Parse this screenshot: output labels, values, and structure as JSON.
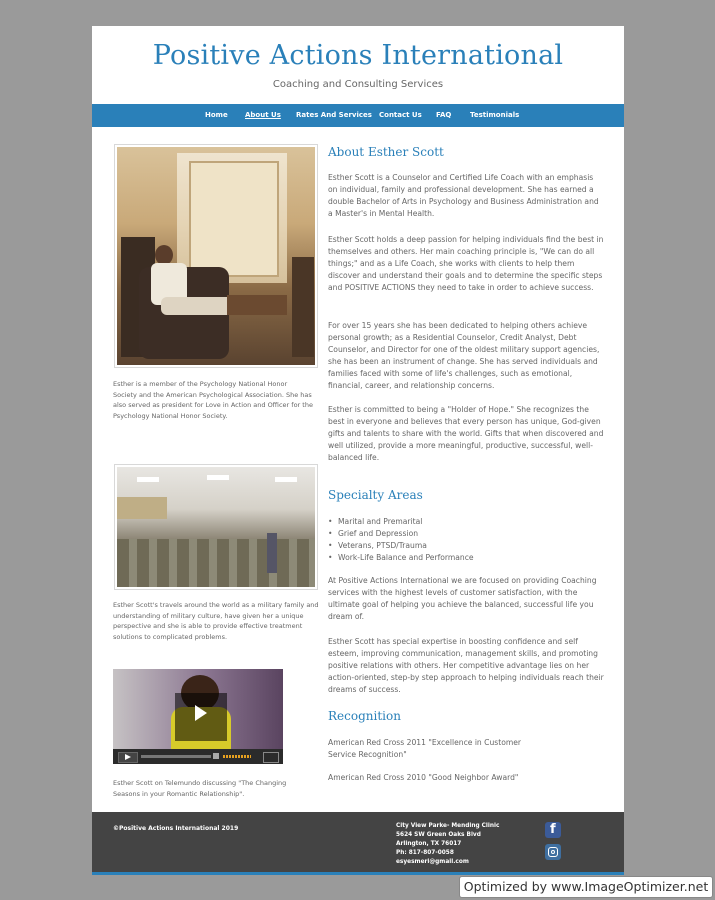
{
  "header": {
    "title": "Positive Actions International",
    "tagline": "Coaching and Consulting Services"
  },
  "nav": {
    "items": [
      "Home",
      "About Us",
      "Rates And Services",
      "Contact Us",
      "FAQ",
      "Testimonials"
    ],
    "active": "About Us"
  },
  "sidebar": {
    "caption1": "Esther is a member of the Psychology National Honor Society and the American Psychological Association.  She has also served as president for Love in Action and Officer for the Psychology National Honor Society.",
    "caption2": "Esther Scott's travels around the world as a military family and understanding of military culture, have given her a unique perspective and she is able to provide effective treatment solutions to complicated problems.",
    "caption3": "Esther Scott on Telemundo discussing \"The Changing Seasons in your Romantic Relationship\"."
  },
  "about": {
    "heading": "About Esther Scott",
    "p1": "Esther Scott is a Counselor and Certified Life Coach with an emphasis on individual, family and professional development.  She has earned a double Bachelor of Arts in Psychology and Business Administration and a Master's in Mental Health.",
    "p2": "Esther Scott holds a deep passion for helping individuals find the best in themselves and others.   Her main coaching principle is, \"We can do all things;\" and as a Life Coach, she works with clients to help them discover and understand their goals and to determine the specific steps and POSITIVE ACTIONS they need to take in order to achieve success.",
    "p3": "For over 15 years she has been dedicated to helping others achieve personal growth; as a Residential Counselor, Credit Analyst, Debt Counselor, and Director for one of the oldest military support agencies, she has been an instrument of change. She has served individuals and families faced with some of life's challenges, such as emotional, financial, career, and relationship concerns.",
    "p4": "Esther is committed to being a \"Holder of Hope.\" She recognizes the best in everyone and believes that every person has unique, God-given gifts and talents to share with the world.  Gifts that when discovered and well utilized, provide a more meaningful, productive, successful, well-balanced life."
  },
  "specialty": {
    "heading": "Specialty Areas",
    "items": [
      "Marital and Premarital",
      "Grief and Depression",
      "Veterans, PTSD/Trauma",
      "Work-Life Balance and Performance"
    ],
    "p1": "At Positive Actions International we are focused on providing Coaching services with the highest levels of customer satisfaction, with the ultimate goal of helping you achieve the  balanced, successful life you dream of.",
    "p2": "Esther Scott has special expertise in boosting confidence and self esteem, improving communication,  management skills, and promoting positive relations with others.  Her competitive advantage lies on her action-oriented, step-by step approach to helping individuals reach their dreams of success."
  },
  "recognition": {
    "heading": "Recognition",
    "p1": "American Red Cross 2011 \"Excellence in Customer Service Recognition\"",
    "p2": "American Red Cross 2010 \"Good Neighbor Award\""
  },
  "footer": {
    "copyright": "©Positive Actions International 2019",
    "address": [
      "City View Parke- Mending Clinic",
      "5624 SW Green Oaks Blvd",
      "Arlington, TX 76017",
      "Ph: 817-807-0058",
      "esyesmeri@gmail.com"
    ]
  },
  "watermark": "Optimized by www.ImageOptimizer.net",
  "colors": {
    "accent": "#2a80b9",
    "footer": "#444444",
    "background": "#9a9a9a"
  }
}
